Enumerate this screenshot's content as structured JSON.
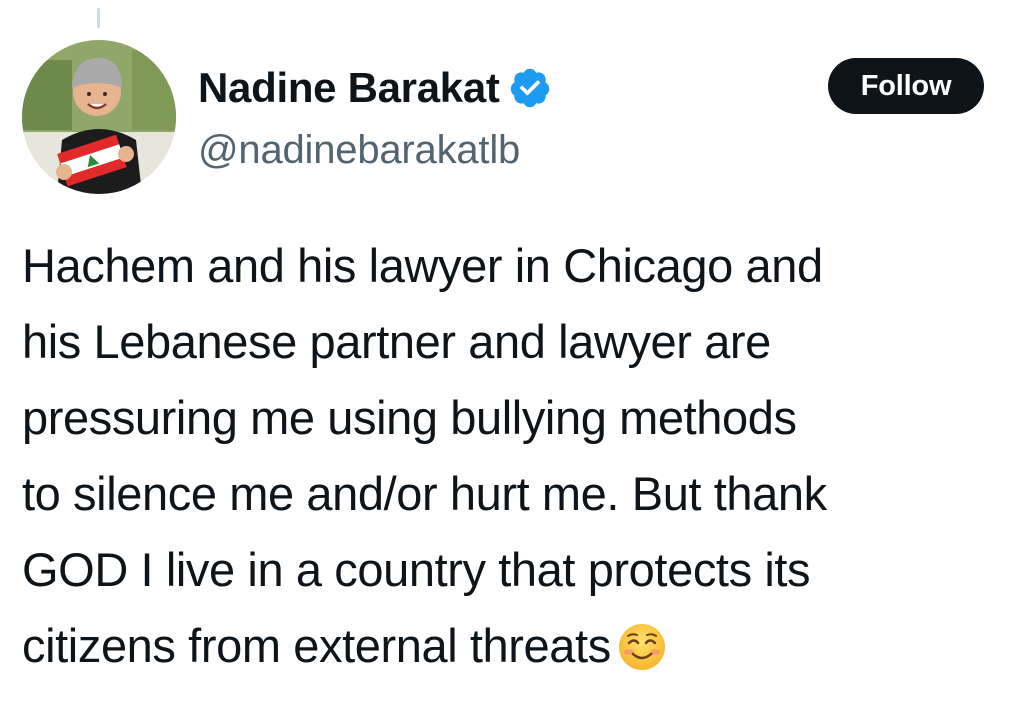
{
  "tweet": {
    "author": {
      "display_name": "Nadine Barakat",
      "handle": "@nadinebarakatlb",
      "verified": true,
      "avatar_icon": "avatar-photo"
    },
    "follow_label": "Follow",
    "text_lines": [
      "Hachem and his lawyer in Chicago and",
      "his Lebanese partner and lawyer are",
      "pressuring me using bullying methods",
      "to silence me and/or hurt me. But thank",
      "GOD I live in a country that protects its",
      "citizens from external threats"
    ],
    "emoji": "smiling-face-with-smiling-eyes-icon"
  },
  "colors": {
    "text": "#0f1419",
    "secondary_text": "#536471",
    "verified_badge": "#1d9bf0",
    "button_bg": "#0f1419",
    "button_text": "#ffffff"
  }
}
